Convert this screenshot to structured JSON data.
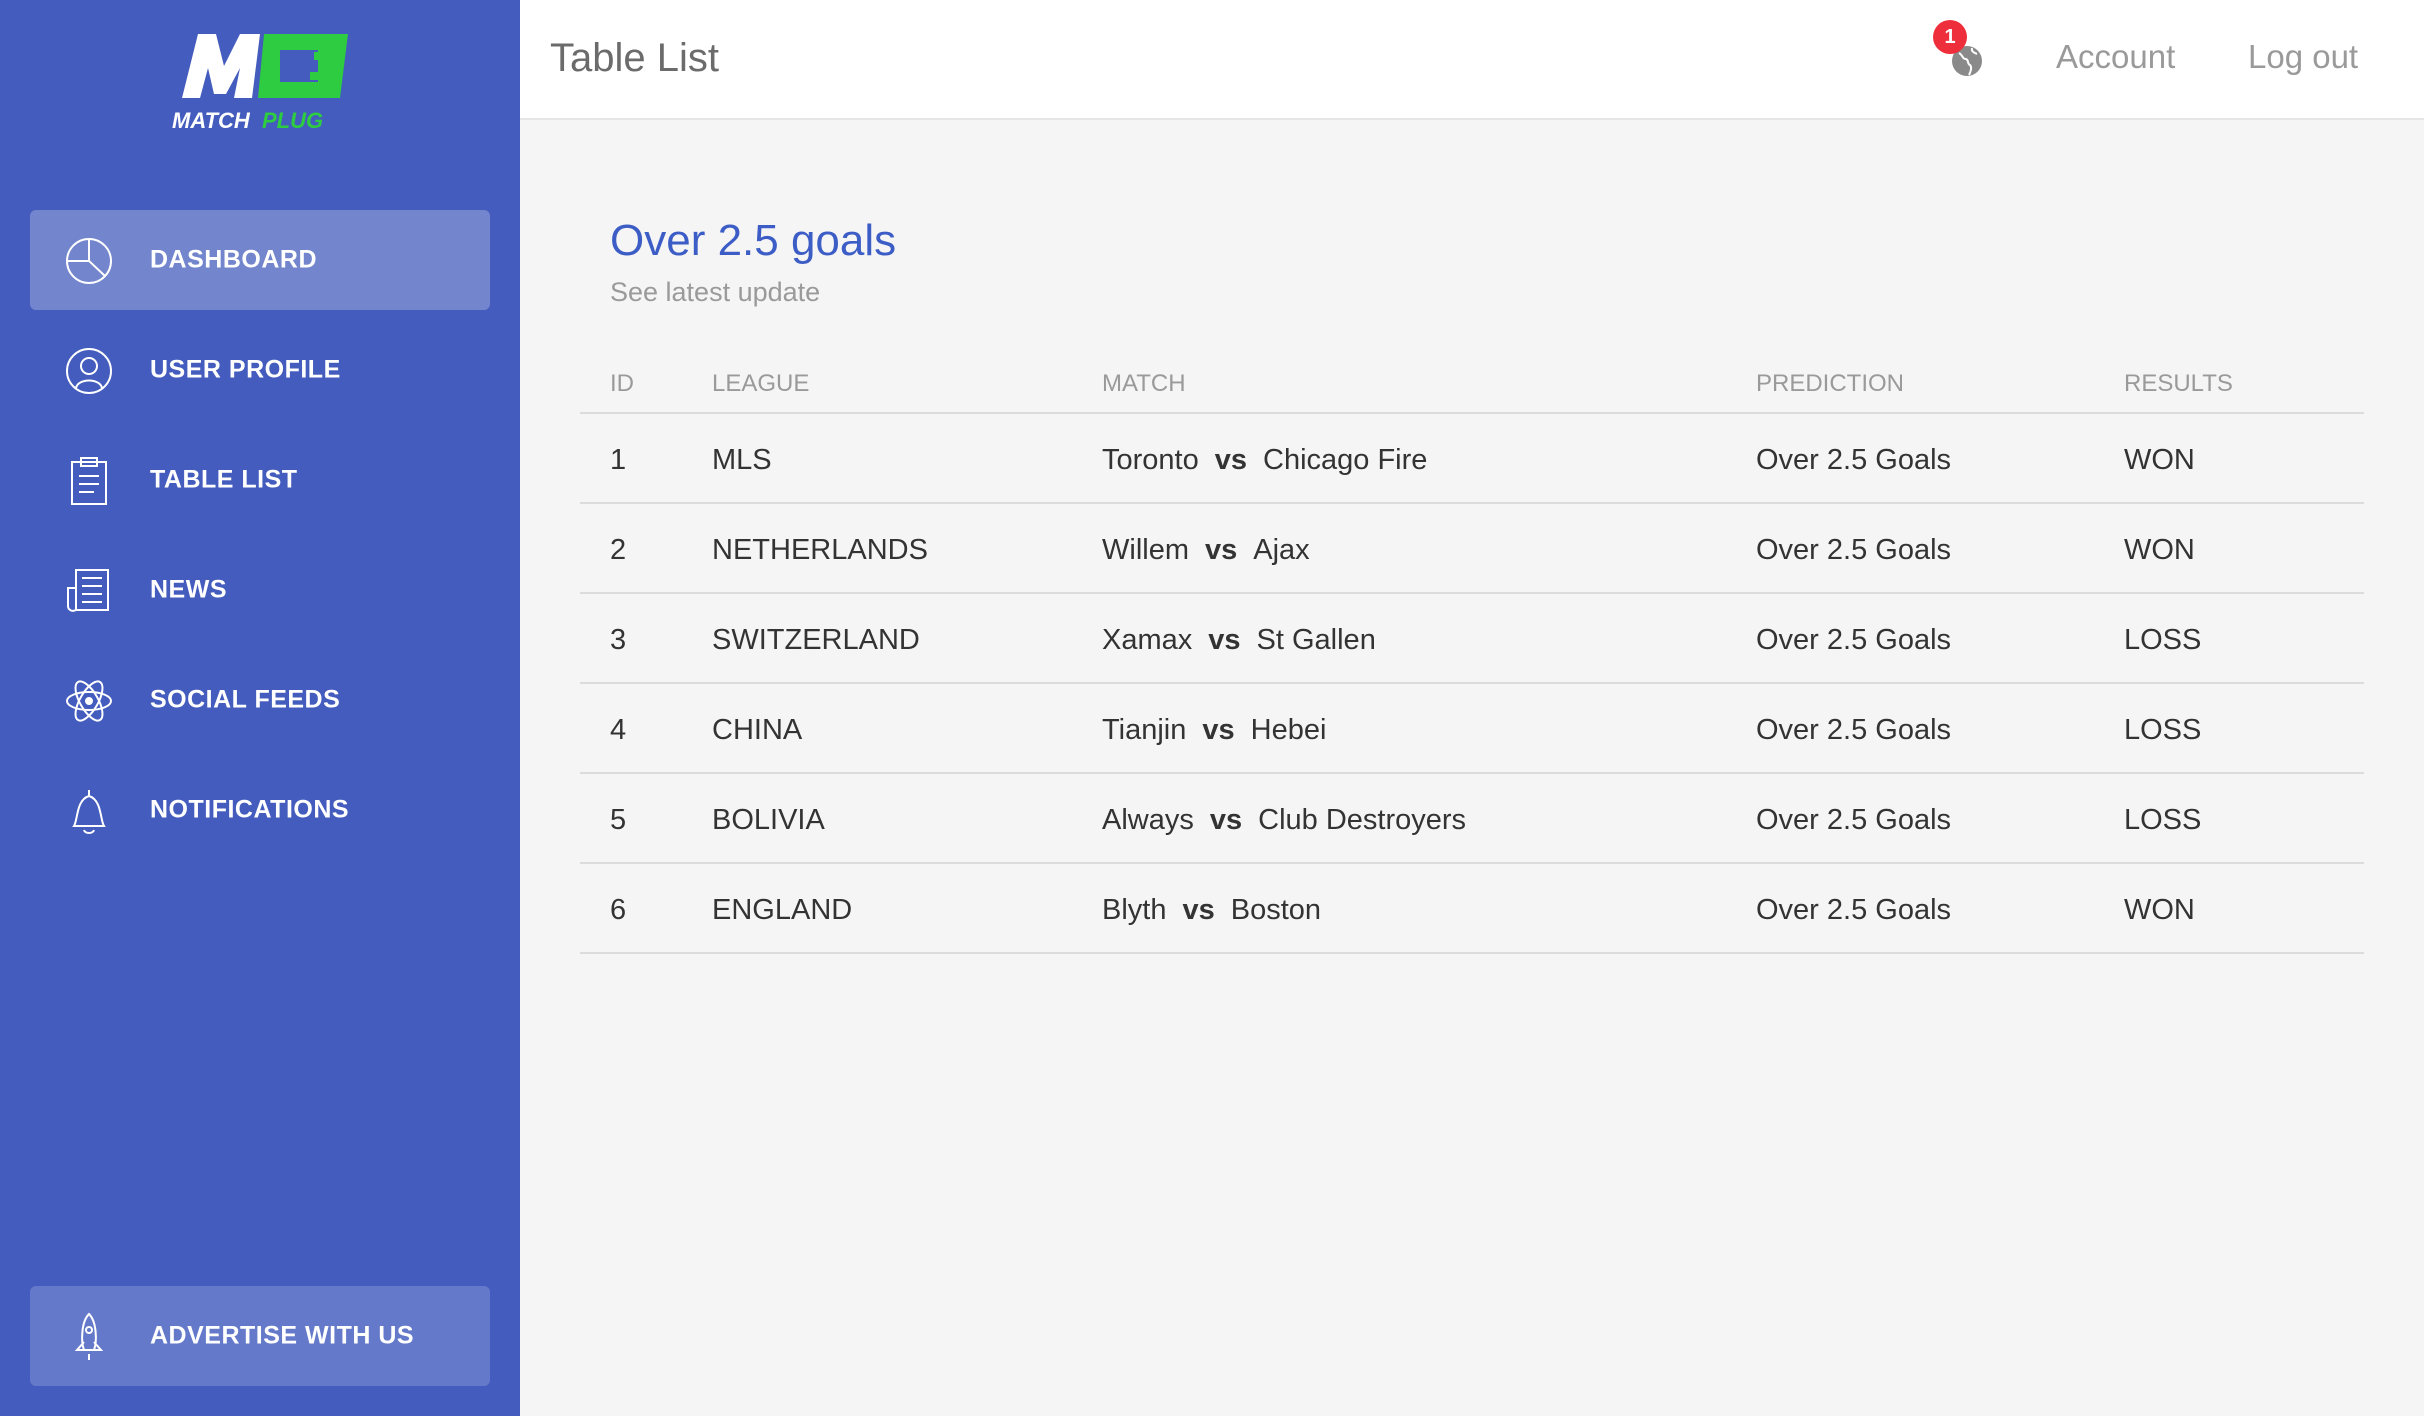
{
  "brand": {
    "logo_text": "MATCHPLUG",
    "logo_mark": "MP",
    "primary_color": "#435cbd",
    "accent_color": "#2ecc40"
  },
  "sidebar": {
    "items": [
      {
        "label": "DASHBOARD",
        "icon": "pie-chart-icon",
        "active": true
      },
      {
        "label": "USER PROFILE",
        "icon": "user-icon",
        "active": false
      },
      {
        "label": "TABLE LIST",
        "icon": "clipboard-icon",
        "active": false
      },
      {
        "label": "NEWS",
        "icon": "newspaper-icon",
        "active": false
      },
      {
        "label": "SOCIAL FEEDS",
        "icon": "atom-icon",
        "active": false
      },
      {
        "label": "NOTIFICATIONS",
        "icon": "bell-icon",
        "active": false
      }
    ],
    "advertise": {
      "label": "ADVERTISE WITH US",
      "icon": "rocket-icon"
    }
  },
  "header": {
    "title": "Table List",
    "notification_count": "1",
    "account_label": "Account",
    "logout_label": "Log out"
  },
  "card": {
    "title": "Over 2.5 goals",
    "subtitle": "See latest update"
  },
  "table": {
    "columns": [
      "ID",
      "LEAGUE",
      "MATCH",
      "PREDICTION",
      "RESULTS"
    ],
    "vs_label": "vs",
    "rows": [
      {
        "id": "1",
        "league": "MLS",
        "home": "Toronto",
        "away": "Chicago Fire",
        "prediction": "Over 2.5 Goals",
        "result": "WON"
      },
      {
        "id": "2",
        "league": "NETHERLANDS",
        "home": "Willem",
        "away": "Ajax",
        "prediction": "Over 2.5 Goals",
        "result": "WON"
      },
      {
        "id": "3",
        "league": "SWITZERLAND",
        "home": "Xamax",
        "away": "St Gallen",
        "prediction": "Over 2.5 Goals",
        "result": "LOSS"
      },
      {
        "id": "4",
        "league": "CHINA",
        "home": "Tianjin",
        "away": "Hebei",
        "prediction": "Over 2.5 Goals",
        "result": "LOSS"
      },
      {
        "id": "5",
        "league": "BOLIVIA",
        "home": "Always",
        "away": "Club Destroyers",
        "prediction": "Over 2.5 Goals",
        "result": "LOSS"
      },
      {
        "id": "6",
        "league": "ENGLAND",
        "home": "Blyth",
        "away": "Boston",
        "prediction": "Over 2.5 Goals",
        "result": "WON"
      }
    ]
  }
}
